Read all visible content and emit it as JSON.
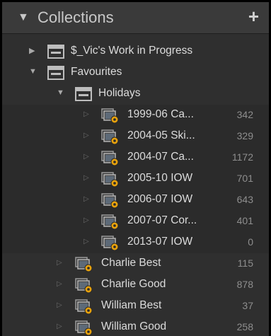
{
  "header": {
    "title": "Collections",
    "collapse_icon": "triangle-down-icon",
    "add_icon": "plus-icon"
  },
  "tree": {
    "vics_work": {
      "label": "$_Vic's Work in Progress"
    },
    "favourites": {
      "label": "Favourites"
    },
    "holidays": {
      "label": "Holidays"
    },
    "holiday_items": [
      {
        "label": "1999-06 Ca...",
        "count": "342"
      },
      {
        "label": "2004-05 Ski...",
        "count": "329"
      },
      {
        "label": "2004-07 Ca...",
        "count": "1172"
      },
      {
        "label": "2005-10 IOW",
        "count": "701"
      },
      {
        "label": "2006-07 IOW",
        "count": "643"
      },
      {
        "label": "2007-07 Cor...",
        "count": "401"
      },
      {
        "label": "2013-07 IOW",
        "count": "0"
      }
    ],
    "favourite_items": [
      {
        "label": "Charlie Best",
        "count": "115"
      },
      {
        "label": "Charlie Good",
        "count": "878"
      },
      {
        "label": "William Best",
        "count": "37"
      },
      {
        "label": "William Good",
        "count": "258"
      }
    ]
  },
  "colors": {
    "panel_bg": "#2f2f2f",
    "header_bg": "#3a3a3a",
    "text": "#dcdcdc",
    "count_text": "#8e8e8e",
    "smart_badge": "#e8a20c"
  }
}
